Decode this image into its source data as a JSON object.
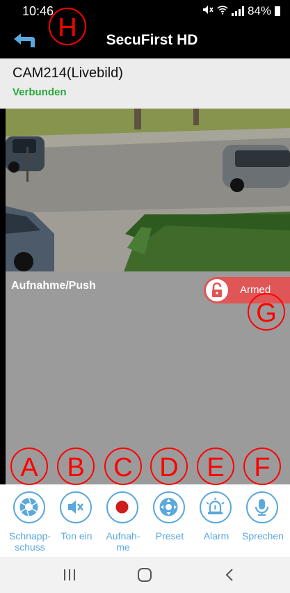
{
  "status_bar": {
    "time": "10:46",
    "battery": "84%"
  },
  "app_bar": {
    "title": "SecuFirst HD"
  },
  "camera": {
    "name": "CAM214(Livebild)",
    "status": "Verbunden"
  },
  "recording": {
    "label": "Aufnahme/Push",
    "armed_label": "Armed"
  },
  "toolbar": {
    "snapshot_label": "Schnapp-\nschuss",
    "sound_label": "Ton ein",
    "record_label": "Aufnah-\nme",
    "preset_label": "Preset",
    "alarm_label": "Alarm",
    "talk_label": "Sprechen"
  },
  "annotations": {
    "a": "A",
    "b": "B",
    "c": "C",
    "d": "D",
    "e": "E",
    "f": "F",
    "g": "G",
    "h": "H"
  },
  "colors": {
    "accent": "#5aa8dc",
    "connected": "#2aa83a",
    "armed": "#e05555",
    "annotation": "#ff0000"
  }
}
